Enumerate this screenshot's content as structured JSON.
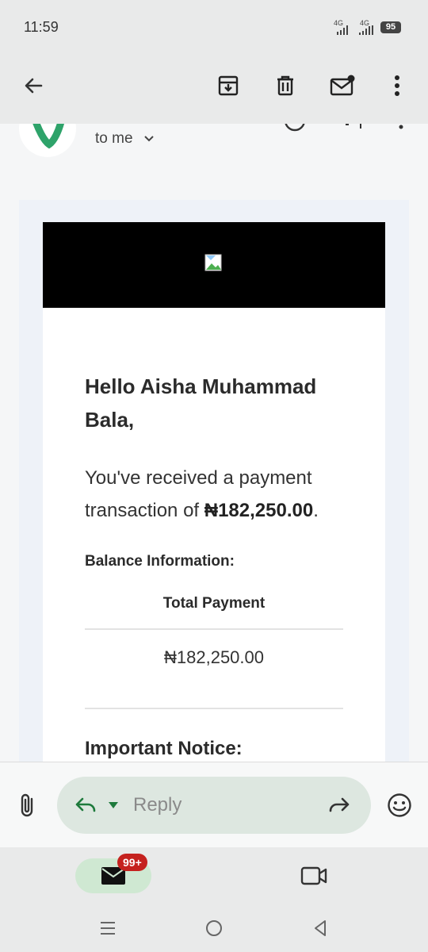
{
  "status_bar": {
    "time": "11:59",
    "signal_1": "4G",
    "signal_2": "4G",
    "battery": "95"
  },
  "toolbar": {
    "icons": [
      "back-arrow-icon",
      "archive-icon",
      "delete-icon",
      "mark-unread-icon",
      "more-vert-icon"
    ]
  },
  "email": {
    "recipient_label": "to me",
    "greeting": "Hello Aisha Muhammad Bala,",
    "body_prefix": "You've received a payment transaction of ",
    "body_amount": "₦182,250.00",
    "body_suffix": ".",
    "balance_title": "Balance Information:",
    "table_header": "Total Payment",
    "table_value": "₦182,250.00",
    "notice_title": "Important Notice:"
  },
  "reply_bar": {
    "placeholder": "Reply"
  },
  "bottom_nav": {
    "mail_badge": "99+"
  },
  "colors": {
    "accent_green": "#1e7a3c",
    "badge_red": "#c5221f",
    "banner_black": "#000000"
  }
}
